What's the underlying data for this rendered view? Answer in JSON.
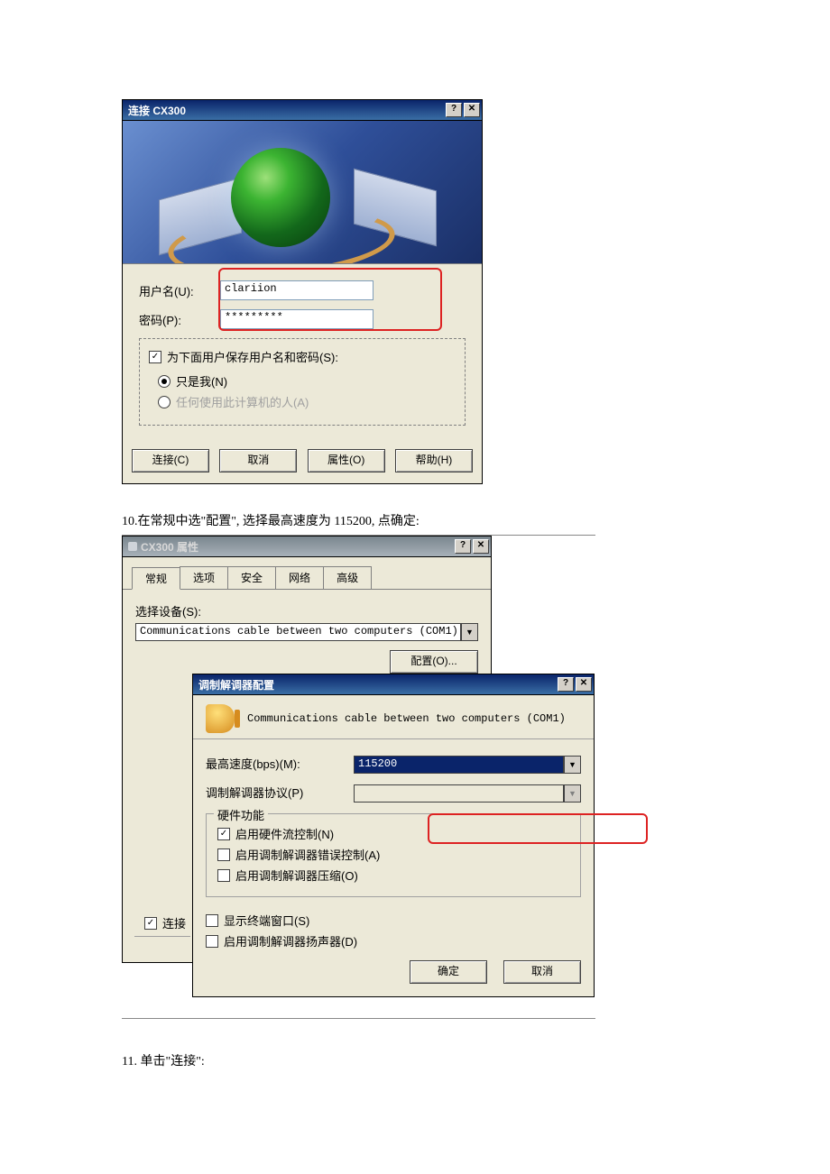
{
  "dialog1": {
    "title": "连接 CX300",
    "help_icon": "?",
    "close_icon": "✕",
    "username_label": "用户名(U):",
    "username_value": "clariion",
    "password_label": "密码(P):",
    "password_value": "*********",
    "save_label": "为下面用户保存用户名和密码(S):",
    "only_me_label": "只是我(N)",
    "anyone_label": "任何使用此计算机的人(A)",
    "btn_connect": "连接(C)",
    "btn_cancel": "取消",
    "btn_properties": "属性(O)",
    "btn_help": "帮助(H)"
  },
  "caption_10": "10.在常规中选\"配置\", 选择最高速度为 115200, 点确定:",
  "dialog2": {
    "title": "CX300 属性",
    "help_icon": "?",
    "close_icon": "✕",
    "tabs": [
      "常规",
      "选项",
      "安全",
      "网络",
      "高级"
    ],
    "select_device_label": "选择设备(S):",
    "device_value": "Communications cable between two computers (COM1)",
    "configure_btn": "配置(O)...",
    "connect_chk": "连接"
  },
  "dialog3": {
    "title": "调制解调器配置",
    "help_icon": "?",
    "close_icon": "✕",
    "device_name": "Communications cable between two computers (COM1)",
    "max_speed_label": "最高速度(bps)(M):",
    "max_speed_value": "115200",
    "protocol_label": "调制解调器协议(P)",
    "hw_group": "硬件功能",
    "hw_flow": "启用硬件流控制(N)",
    "modem_err": "启用调制解调器错误控制(A)",
    "modem_comp": "启用调制解调器压缩(O)",
    "show_term": "显示终端窗口(S)",
    "speaker": "启用调制解调器扬声器(D)",
    "btn_ok": "确定",
    "btn_cancel": "取消"
  },
  "caption_11": "11.  单击\"连接\":"
}
